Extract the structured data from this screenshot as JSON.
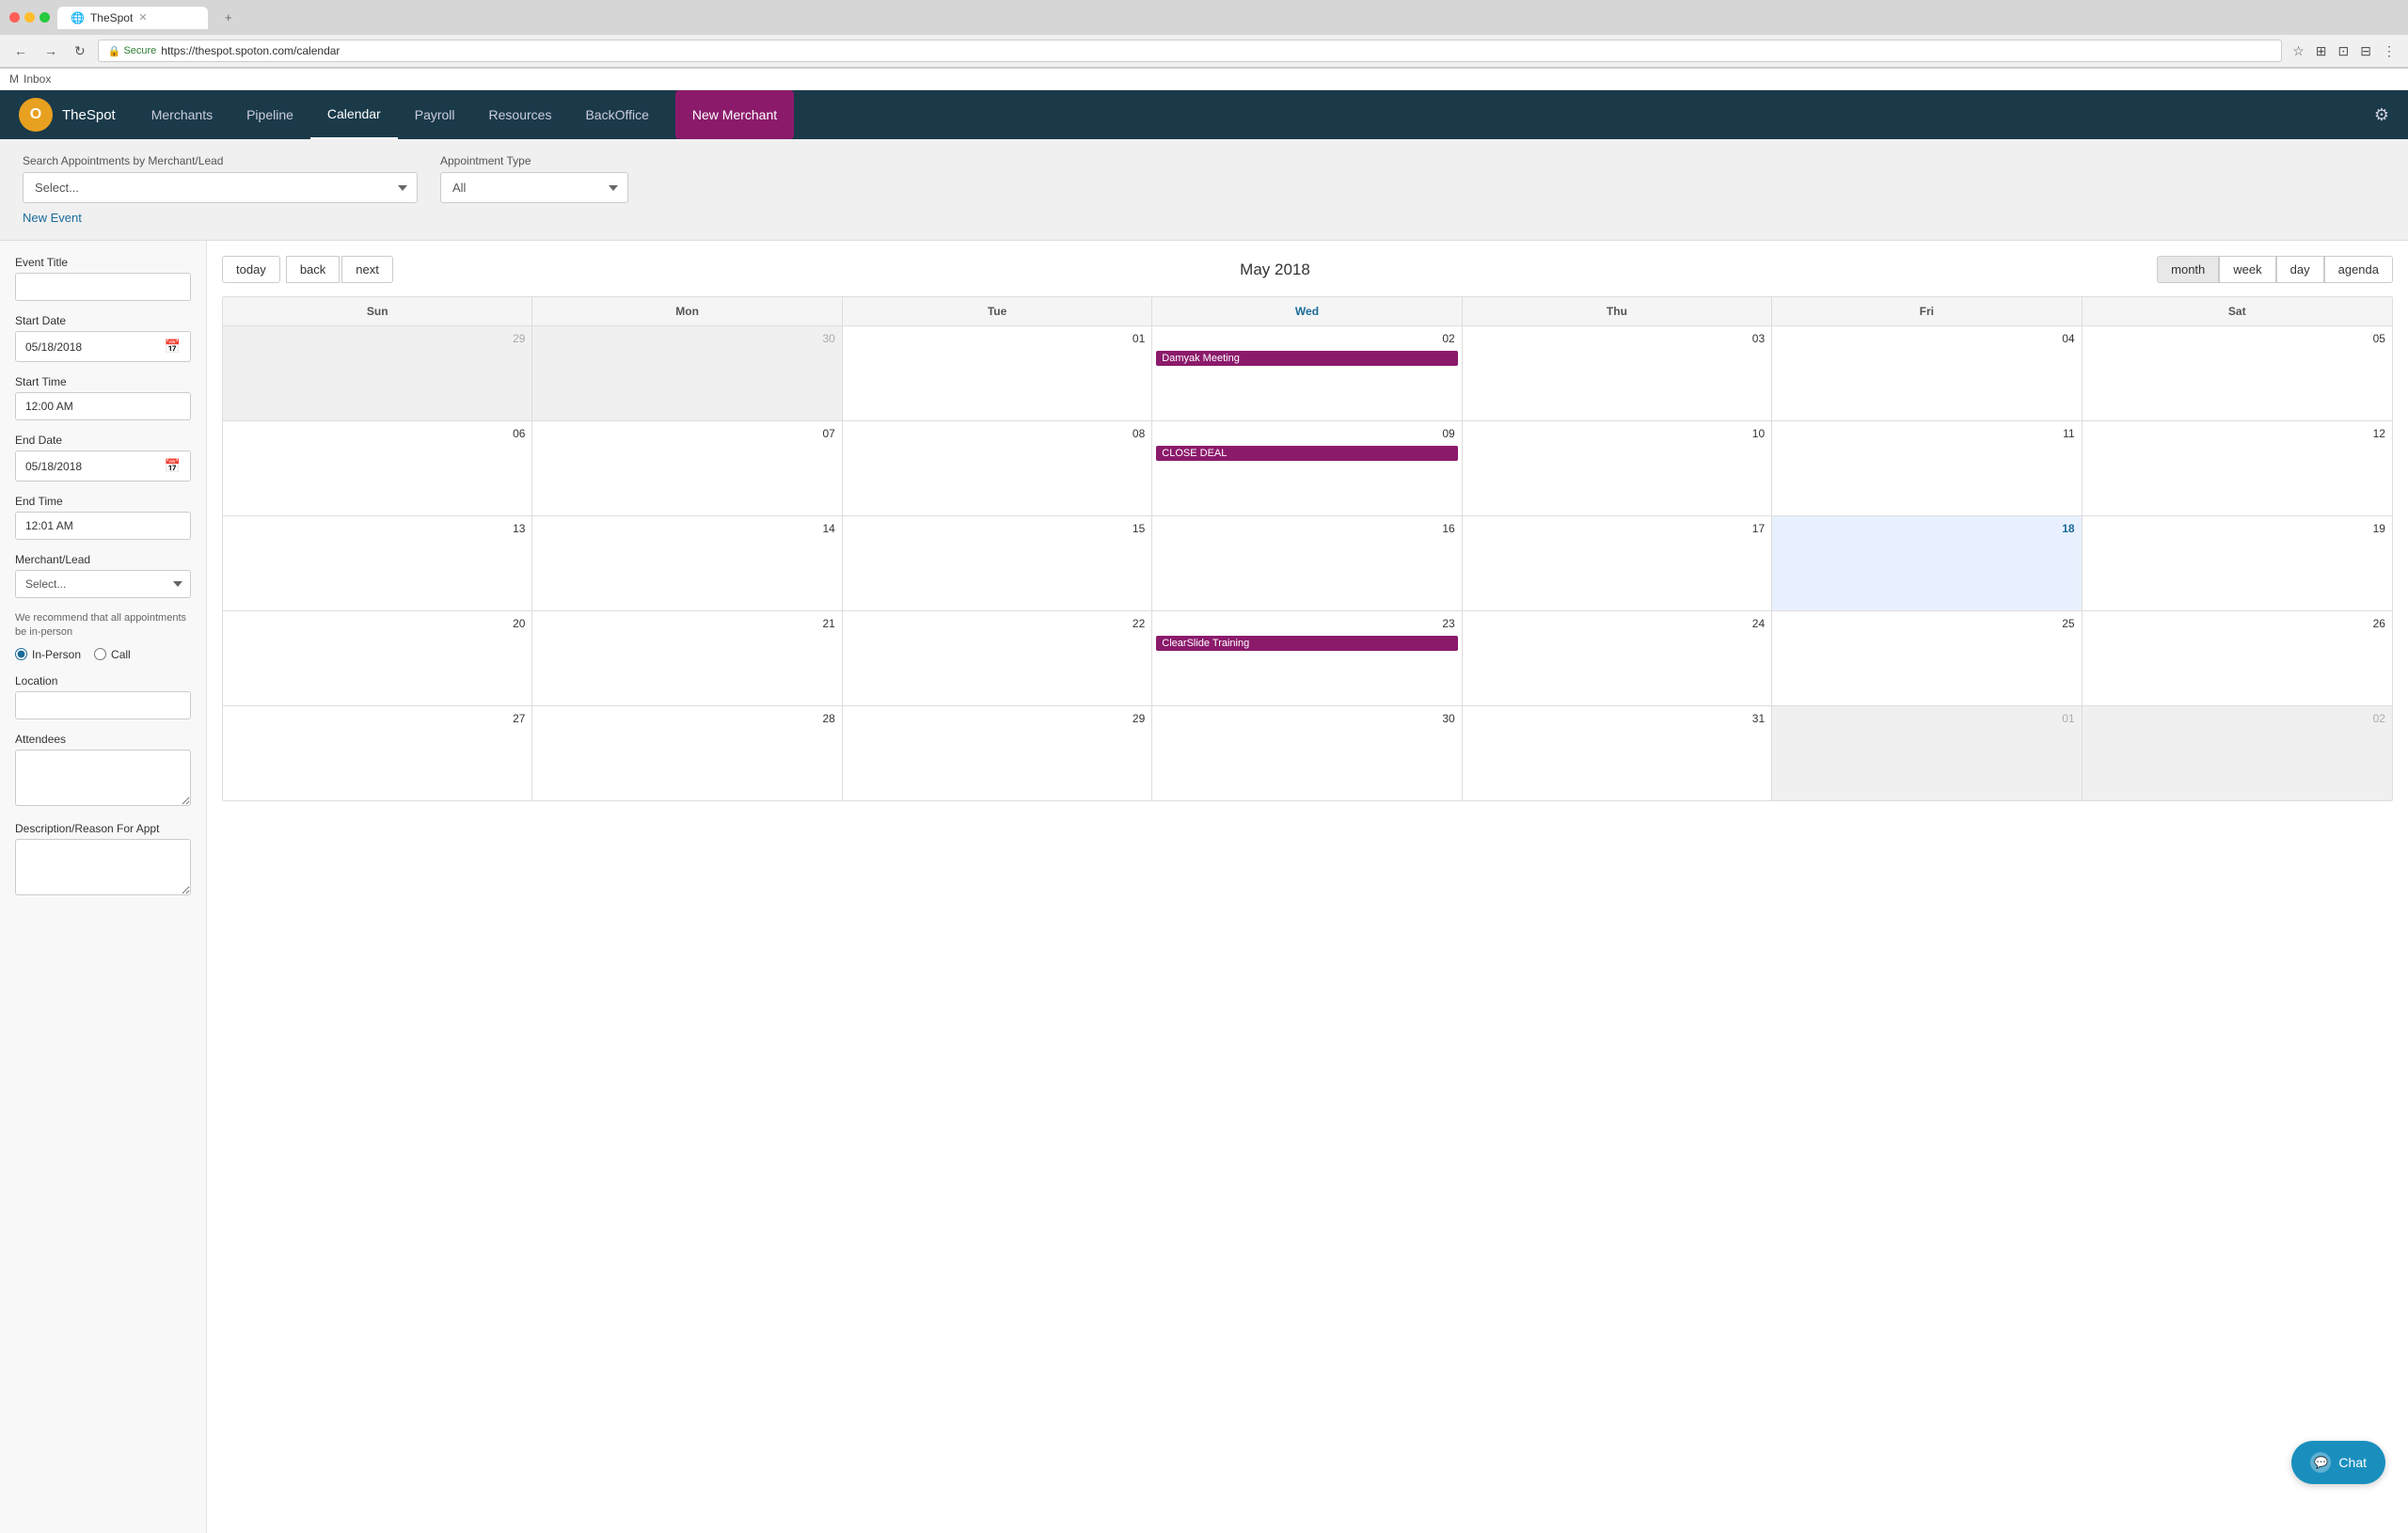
{
  "browser": {
    "tab_title": "TheSpot",
    "address": "https://thespot.spoton.com/calendar",
    "secure_label": "Secure"
  },
  "gmail": {
    "label": "Inbox"
  },
  "nav": {
    "logo_text": "O",
    "brand": "TheSpot",
    "links": [
      "Merchants",
      "Pipeline",
      "Calendar",
      "Payroll",
      "Resources",
      "BackOffice"
    ],
    "active_link": "Calendar",
    "new_merchant_label": "New Merchant",
    "settings_label": "Settings"
  },
  "filter": {
    "search_label": "Search Appointments by Merchant/Lead",
    "search_placeholder": "Select...",
    "appointment_type_label": "Appointment Type",
    "appointment_type_placeholder": "All",
    "new_event_label": "New Event"
  },
  "event_form": {
    "title_label": "Event Title",
    "title_value": "",
    "start_date_label": "Start Date",
    "start_date_value": "05/18/2018",
    "start_time_label": "Start Time",
    "start_time_value": "12:00 AM",
    "end_date_label": "End Date",
    "end_date_value": "05/18/2018",
    "end_time_label": "End Time",
    "end_time_value": "12:01 AM",
    "merchant_lead_label": "Merchant/Lead",
    "merchant_lead_placeholder": "Select...",
    "recommend_text": "We recommend that all appointments be in-person",
    "in_person_label": "In-Person",
    "call_label": "Call",
    "location_label": "Location",
    "location_value": "",
    "attendees_label": "Attendees",
    "attendees_value": "",
    "description_label": "Description/Reason For Appt"
  },
  "calendar": {
    "month_year": "May 2018",
    "nav": {
      "today": "today",
      "back": "back",
      "next": "next"
    },
    "views": [
      "month",
      "week",
      "day",
      "agenda"
    ],
    "active_view": "month",
    "day_headers": [
      "Sun",
      "Mon",
      "Tue",
      "Wed",
      "Thu",
      "Fri",
      "Sat"
    ],
    "weeks": [
      {
        "days": [
          {
            "num": "29",
            "other_month": true,
            "today": false,
            "events": []
          },
          {
            "num": "30",
            "other_month": true,
            "today": false,
            "events": []
          },
          {
            "num": "01",
            "other_month": false,
            "today": false,
            "events": []
          },
          {
            "num": "02",
            "other_month": false,
            "today": false,
            "events": [
              {
                "title": "Damyak Meeting"
              }
            ]
          },
          {
            "num": "03",
            "other_month": false,
            "today": false,
            "events": []
          },
          {
            "num": "04",
            "other_month": false,
            "today": false,
            "events": []
          },
          {
            "num": "05",
            "other_month": false,
            "today": false,
            "events": []
          }
        ]
      },
      {
        "days": [
          {
            "num": "06",
            "other_month": false,
            "today": false,
            "events": []
          },
          {
            "num": "07",
            "other_month": false,
            "today": false,
            "events": []
          },
          {
            "num": "08",
            "other_month": false,
            "today": false,
            "events": []
          },
          {
            "num": "09",
            "other_month": false,
            "today": false,
            "events": [
              {
                "title": "CLOSE DEAL"
              }
            ]
          },
          {
            "num": "10",
            "other_month": false,
            "today": false,
            "events": []
          },
          {
            "num": "11",
            "other_month": false,
            "today": false,
            "events": []
          },
          {
            "num": "12",
            "other_month": false,
            "today": false,
            "events": []
          }
        ]
      },
      {
        "days": [
          {
            "num": "13",
            "other_month": false,
            "today": false,
            "events": []
          },
          {
            "num": "14",
            "other_month": false,
            "today": false,
            "events": []
          },
          {
            "num": "15",
            "other_month": false,
            "today": false,
            "events": []
          },
          {
            "num": "16",
            "other_month": false,
            "today": false,
            "events": []
          },
          {
            "num": "17",
            "other_month": false,
            "today": false,
            "events": []
          },
          {
            "num": "18",
            "other_month": false,
            "today": true,
            "events": []
          },
          {
            "num": "19",
            "other_month": false,
            "today": false,
            "events": []
          }
        ]
      },
      {
        "days": [
          {
            "num": "20",
            "other_month": false,
            "today": false,
            "events": []
          },
          {
            "num": "21",
            "other_month": false,
            "today": false,
            "events": []
          },
          {
            "num": "22",
            "other_month": false,
            "today": false,
            "events": []
          },
          {
            "num": "23",
            "other_month": false,
            "today": false,
            "events": [
              {
                "title": "ClearSlide Training"
              }
            ]
          },
          {
            "num": "24",
            "other_month": false,
            "today": false,
            "events": []
          },
          {
            "num": "25",
            "other_month": false,
            "today": false,
            "events": []
          },
          {
            "num": "26",
            "other_month": false,
            "today": false,
            "events": []
          }
        ]
      },
      {
        "days": [
          {
            "num": "27",
            "other_month": false,
            "today": false,
            "events": []
          },
          {
            "num": "28",
            "other_month": false,
            "today": false,
            "events": []
          },
          {
            "num": "29",
            "other_month": false,
            "today": false,
            "events": []
          },
          {
            "num": "30",
            "other_month": false,
            "today": false,
            "events": []
          },
          {
            "num": "31",
            "other_month": false,
            "today": false,
            "events": []
          },
          {
            "num": "01",
            "other_month": true,
            "today": false,
            "events": []
          },
          {
            "num": "02",
            "other_month": true,
            "today": false,
            "events": []
          }
        ]
      }
    ]
  },
  "chat": {
    "label": "Chat"
  }
}
